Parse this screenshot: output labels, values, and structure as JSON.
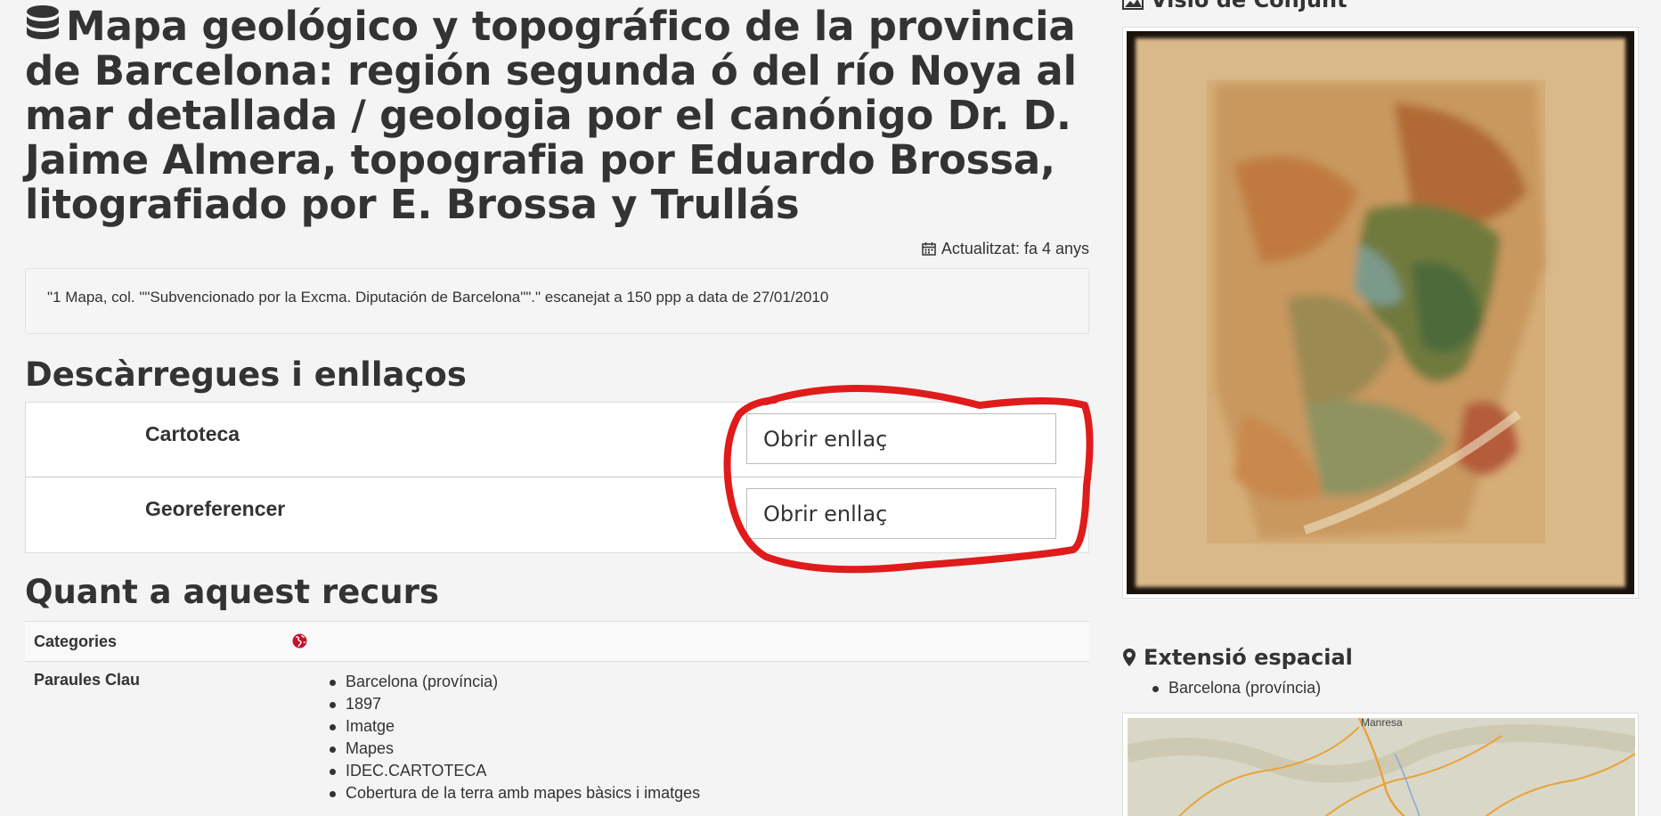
{
  "title": "Mapa geológico y topográfico de la provincia de Barcelona: región segunda ó del río Noya al mar detallada / geologia por el canónigo Dr. D. Jaime Almera, topografia por Eduardo Brossa, litografiado por E. Brossa y Trullás",
  "updated": "Actualitzat: fa 4 anys",
  "notes": "\"1 Mapa, col. \"\"Subvencionado por la Excma. Diputación de Barcelona\"\".\" escanejat a 150 ppp a data de 27/01/2010",
  "downloads": {
    "title": "Descàrregues i enllaços",
    "items": [
      {
        "name": "Cartoteca",
        "button": "Obrir enllaç"
      },
      {
        "name": "Georeferencer",
        "button": "Obrir enllaç"
      }
    ]
  },
  "about": {
    "title": "Quant a aquest recurs",
    "categories_label": "Categories",
    "keywords_label": "Paraules Clau",
    "keywords": [
      "Barcelona (província)",
      "1897",
      "Imatge",
      "Mapes",
      "IDEC.CARTOTECA",
      "Cobertura de la terra amb mapes bàsics i imatges"
    ]
  },
  "sidebar": {
    "overview_title": "Visió de Conjunt",
    "extent_title": "Extensió espacial",
    "extent_items": [
      "Barcelona (província)"
    ],
    "map_label": "Manresa"
  },
  "colors": {
    "annotation": "#e01b1b",
    "text": "#333333",
    "background": "#f4f4f4"
  }
}
